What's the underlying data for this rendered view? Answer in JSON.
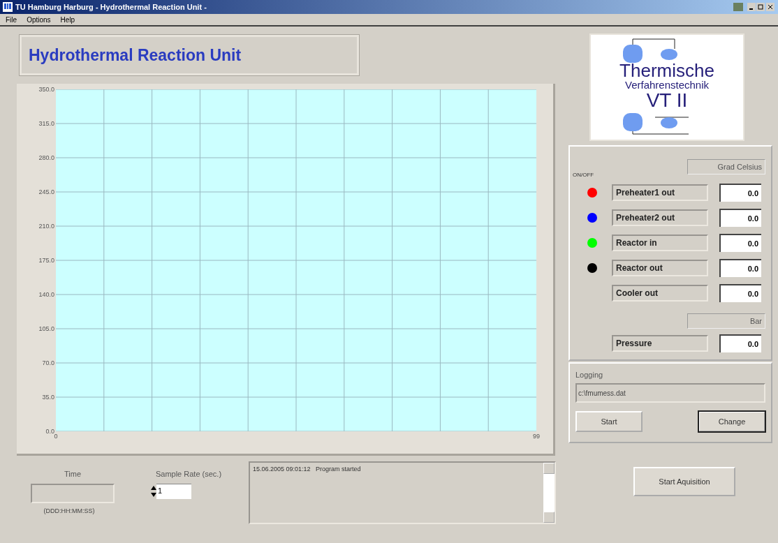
{
  "window": {
    "title": "TU Hamburg Harburg - Hydrothermal Reaction Unit -"
  },
  "menu": [
    "File",
    "Options",
    "Help"
  ],
  "heading": "Hydrothermal Reaction Unit",
  "chart": {
    "chart_data": {
      "type": "line",
      "grid": true,
      "xlim": [
        0,
        99
      ],
      "ylim": [
        0,
        350
      ],
      "xticks": [
        0,
        99
      ],
      "yticks": [
        {
          "value": 0,
          "label": "0.0"
        },
        {
          "value": 35,
          "label": "35.0"
        },
        {
          "value": 70,
          "label": "70.0"
        },
        {
          "value": 105,
          "label": "105.0"
        },
        {
          "value": 140,
          "label": "140.0"
        },
        {
          "value": 175,
          "label": "175.0"
        },
        {
          "value": 210,
          "label": "210.0"
        },
        {
          "value": 245,
          "label": "245.0"
        },
        {
          "value": 280,
          "label": "280.0"
        },
        {
          "value": 315,
          "label": "315.0"
        },
        {
          "value": 350,
          "label": "350.0"
        }
      ]
    }
  },
  "time": {
    "label": "Time",
    "format": "(DDD:HH:MM:SS)"
  },
  "sample_rate": {
    "label": "Sample Rate (sec.)",
    "value": "1"
  },
  "log": [
    "15.06.2005 09:01:12   Program started"
  ],
  "logo": {
    "line_1": "Thermische",
    "line_2": "Verfahrenstechnik",
    "line_3": "VT II"
  },
  "temperature": {
    "unit": "Grad Celsius",
    "toggle_label": "ON/OFF",
    "channels": [
      {
        "name": "Preheater1 out",
        "value": "0.0",
        "color": "#ff0000"
      },
      {
        "name": "Preheater2 out",
        "value": "0.0",
        "color": "#0000ff"
      },
      {
        "name": "Reactor in",
        "value": "0.0",
        "color": "#00ff00"
      },
      {
        "name": "Reactor out",
        "value": "0.0",
        "color": "#000000"
      },
      {
        "name": "Cooler out",
        "value": "0.0"
      }
    ]
  },
  "pressure": {
    "unit": "Bar",
    "name": "Pressure",
    "value": "0.0"
  },
  "logging": {
    "label": "Logging",
    "path": "c:\\fmumess.dat",
    "buttons": [
      {
        "label": "Start",
        "default": false
      },
      {
        "label": "Change",
        "default": true
      }
    ]
  },
  "start_button": "Start Aquisition"
}
